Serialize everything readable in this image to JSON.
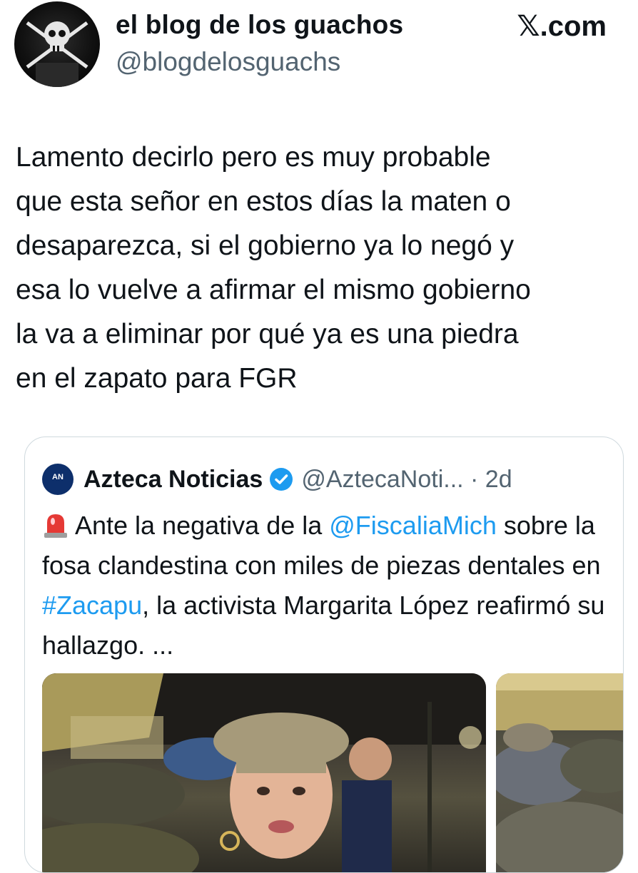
{
  "header": {
    "display_name": "el blog de los guachos",
    "handle": "@blogdelosguachs",
    "site": "𝕏.com"
  },
  "tweet": {
    "text": "Lamento decirlo pero es muy probable\nque esta señor en estos días la maten o\ndesaparezca, si el gobierno ya lo negó y\nesa lo vuelve a afirmar el mismo gobierno\nla va a eliminar por qué ya es una piedra\nen el zapato para FGR"
  },
  "quote": {
    "logo_text": "AN",
    "name": "Azteca Noticias",
    "handle_time": "@AztecaNoti... · 2d",
    "text_1": "Ante la negativa de la ",
    "mention": "@FiscaliaMich",
    "text_2": " sobre la fosa clandestina con miles de piezas dentales en ",
    "hashtag": "#Zacapu",
    "text_3": ", la activista Margarita López reafirmó su hallazgo. ...",
    "icons": [
      "siren-emoji",
      "verified-badge-icon"
    ]
  },
  "colors": {
    "link": "#1d9bf0",
    "secondary_text": "#536471",
    "border": "#cfd9de"
  }
}
